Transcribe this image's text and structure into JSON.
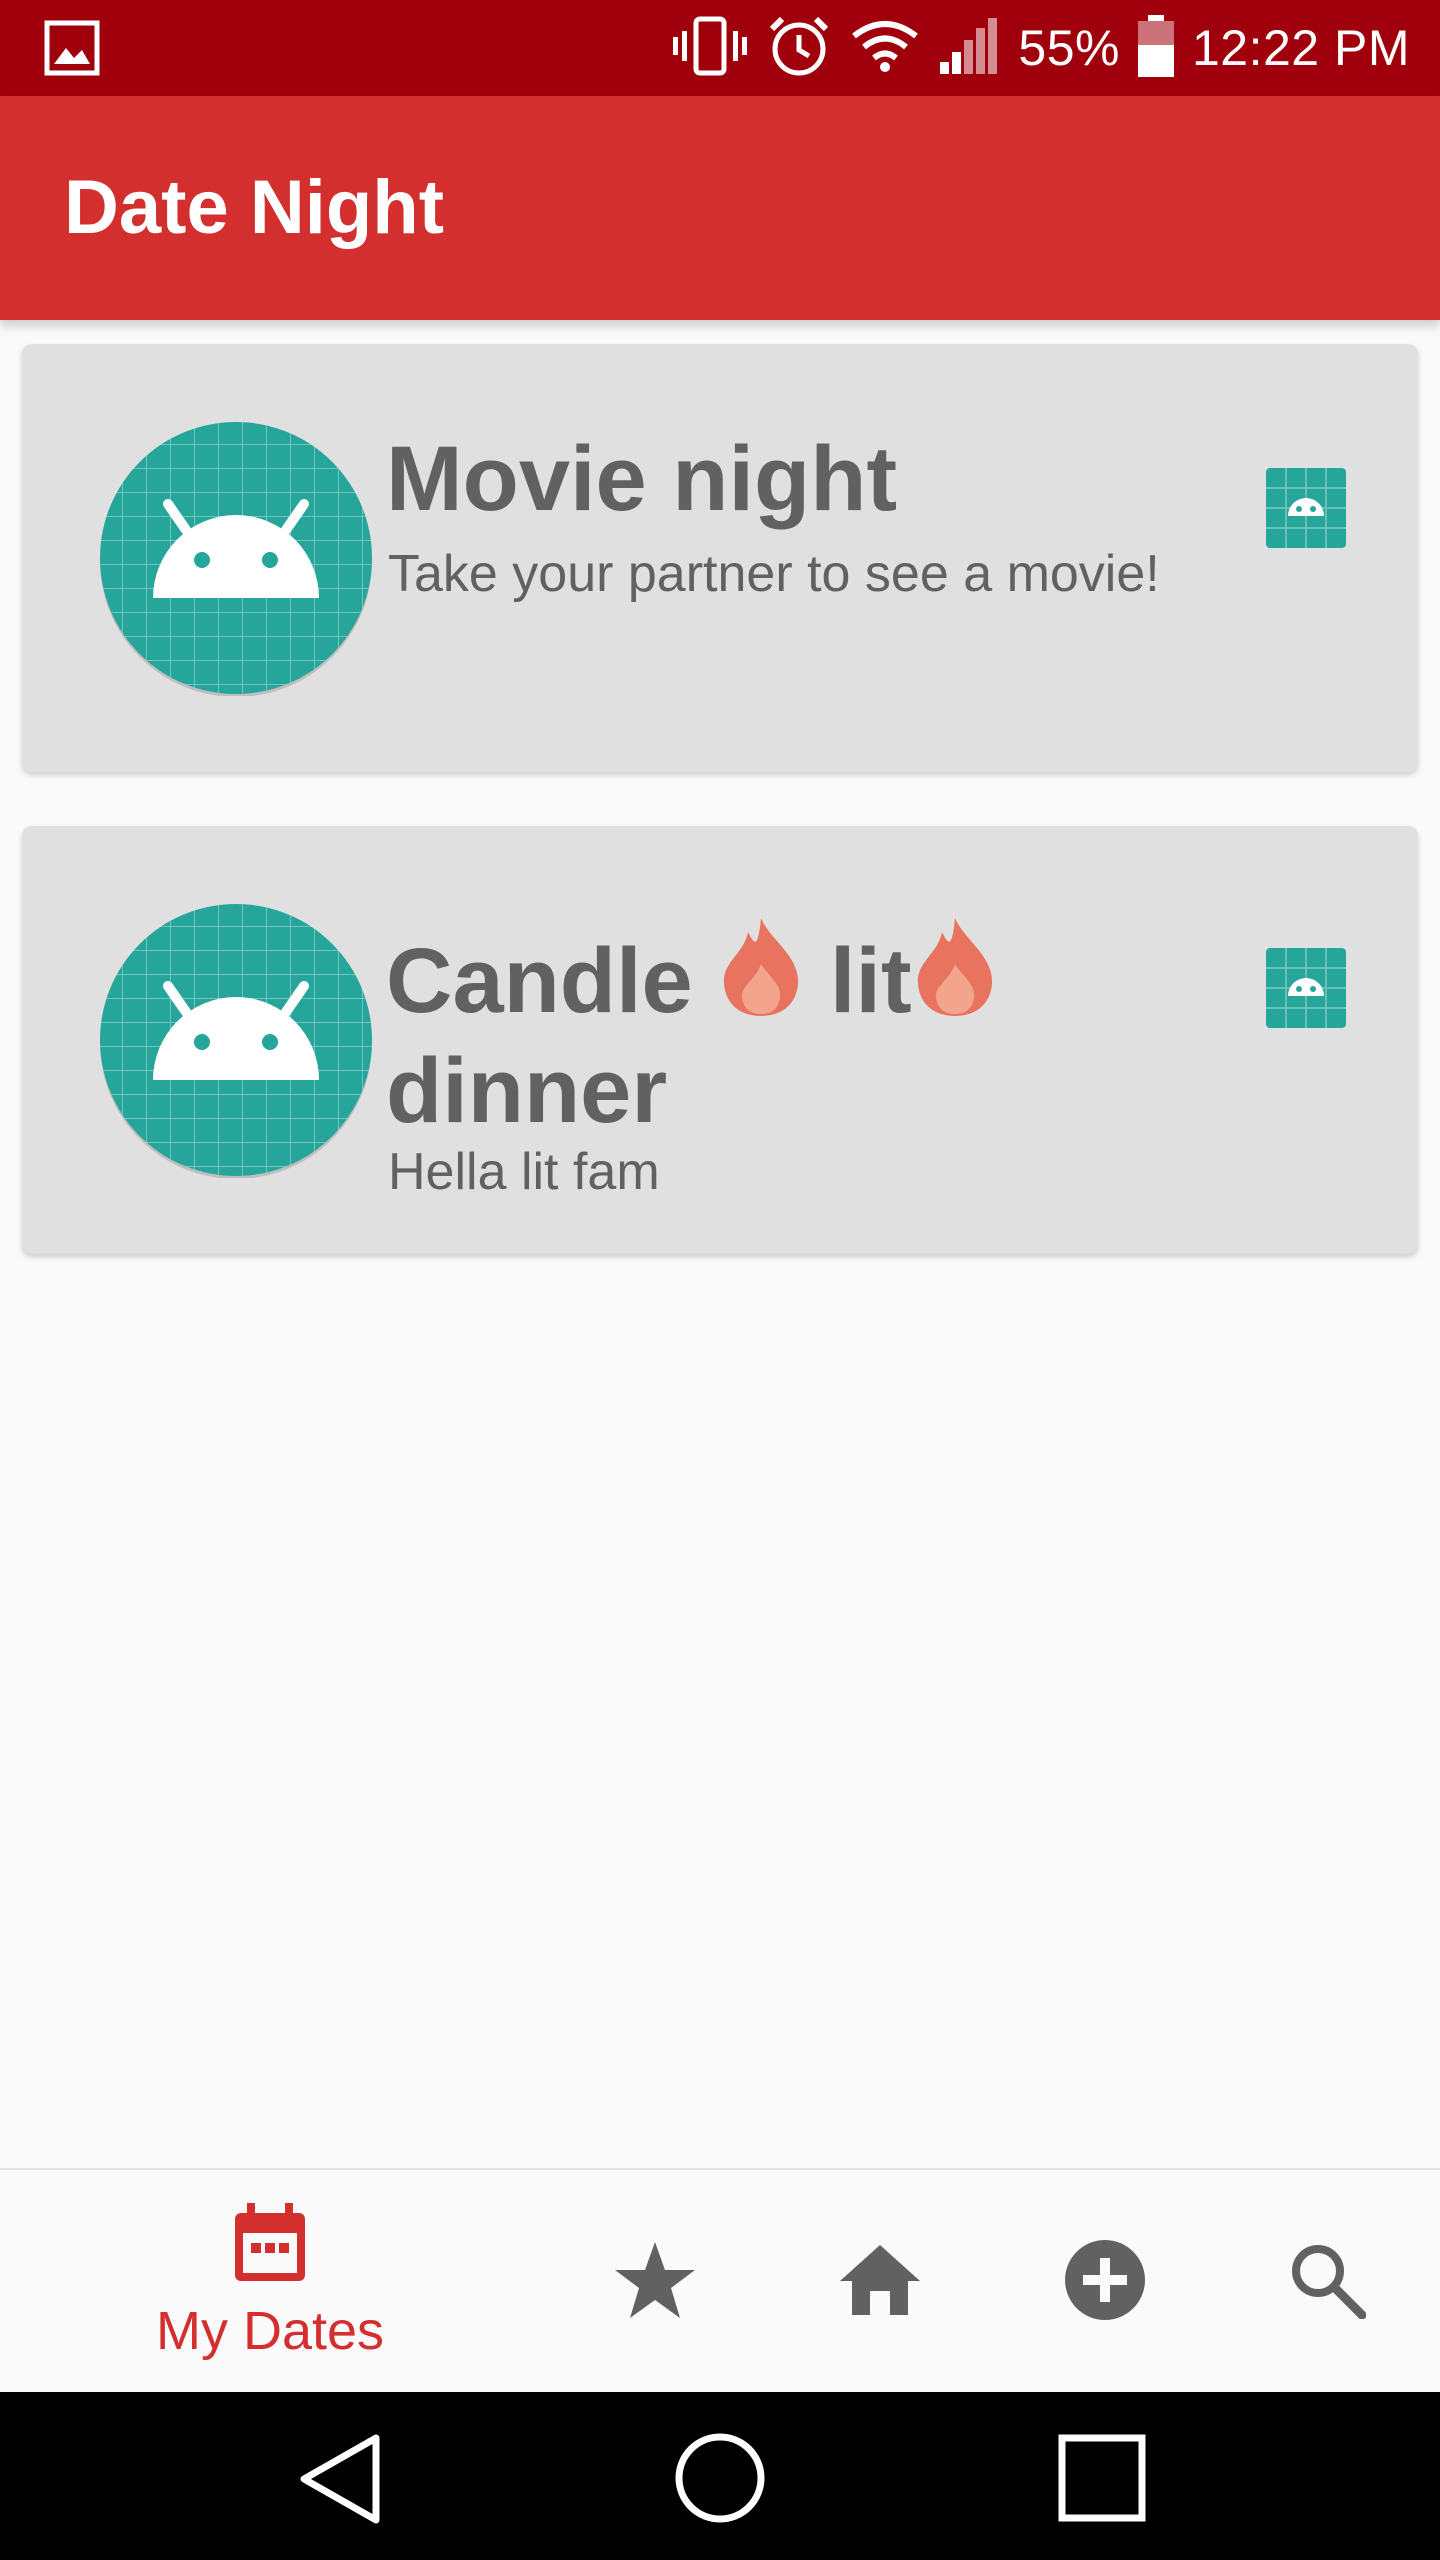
{
  "status_bar": {
    "battery_percent": "55%",
    "time": "12:22 PM"
  },
  "app_bar": {
    "title": "Date Night"
  },
  "dates": [
    {
      "title": "Movie night",
      "description": "Take your partner to see a movie!"
    },
    {
      "title_part1": "Candle ",
      "title_part2": " lit",
      "title_part3": "dinner",
      "description": "Hella lit fam"
    }
  ],
  "bottom_nav": {
    "active_label": "My Dates",
    "items": [
      "calendar-icon",
      "star-icon",
      "home-icon",
      "add-circle-icon",
      "search-icon"
    ]
  },
  "colors": {
    "status_bar": "#a0000b",
    "app_bar": "#d32f2f",
    "card": "#e0e0e0",
    "accent": "#d32f2f",
    "teal": "#26a69a"
  }
}
